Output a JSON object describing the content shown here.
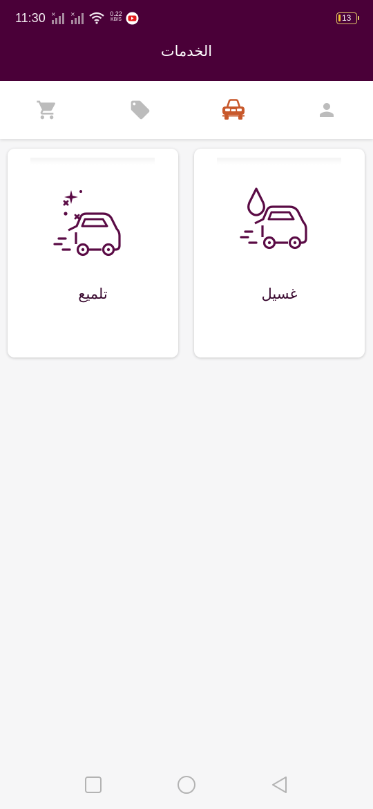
{
  "status_bar": {
    "time": "11:30",
    "net_speed_value": "0.22",
    "net_speed_unit": "KB/S",
    "battery_level": "13",
    "icons": [
      "signal-icon",
      "signal-icon",
      "wifi-icon",
      "youtube-icon",
      "battery-icon"
    ]
  },
  "header": {
    "title": "الخدمات",
    "background_color": "#4a0038"
  },
  "tabs": [
    {
      "name": "cart",
      "icon": "cart-icon",
      "active": false
    },
    {
      "name": "offers",
      "icon": "tag-icon",
      "active": false
    },
    {
      "name": "services",
      "icon": "car-icon",
      "active": true
    },
    {
      "name": "profile",
      "icon": "person-icon",
      "active": false
    }
  ],
  "colors": {
    "active_tab": "#c8582b",
    "inactive_tab": "#bcbcbc",
    "icon_primary": "#5a0b45"
  },
  "services": [
    {
      "label": "غسيل",
      "icon": "car-wash-icon"
    },
    {
      "label": "تلميع",
      "icon": "car-polish-icon"
    }
  ],
  "nav_bar": {
    "buttons": [
      "recent-apps-button",
      "home-button",
      "back-button"
    ]
  }
}
